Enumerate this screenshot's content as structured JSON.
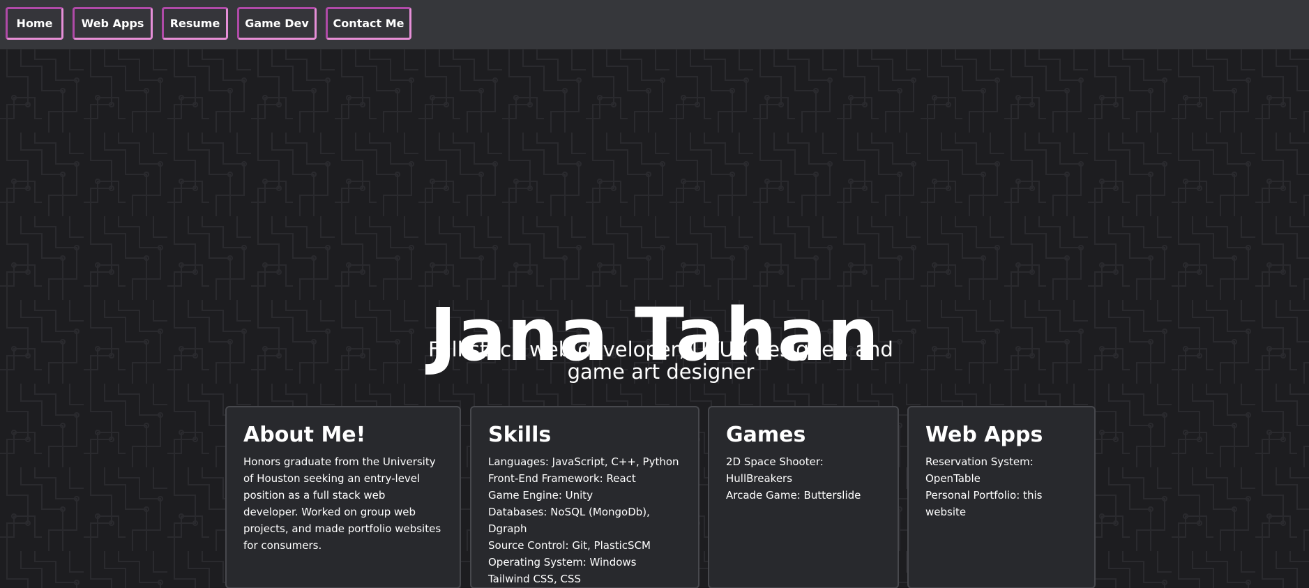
{
  "nav": {
    "items": [
      {
        "label": "Home"
      },
      {
        "label": "Web Apps"
      },
      {
        "label": "Resume"
      },
      {
        "label": "Game Dev"
      },
      {
        "label": "Contact Me"
      }
    ]
  },
  "hero": {
    "name": "Jana Tahan",
    "tagline": "Full stack web developer, UI/UX designer, and game art designer"
  },
  "cards": {
    "about": {
      "title": "About Me!",
      "text": "Honors graduate from the University of Houston seeking an entry-level position as a full stack web developer. Worked on group web projects, and made portfolio websites for consumers."
    },
    "skills": {
      "title": "Skills",
      "lines": [
        "Languages: JavaScript, C++, Python",
        "Front-End Framework: React",
        "Game Engine: Unity",
        "Databases: NoSQL (MongoDb), Dgraph",
        "Source Control: Git, PlasticSCM",
        "Operating System: Windows",
        "Tailwind CSS, CSS"
      ]
    },
    "games": {
      "title": "Games",
      "lines": [
        "2D Space Shooter: HullBreakers",
        "Arcade Game: Butterslide"
      ]
    },
    "webapps": {
      "title": "Web Apps",
      "lines": [
        "Reservation System: OpenTable",
        "Personal Portfolio: this website"
      ]
    }
  },
  "colors": {
    "navbar_bg": "#36373b",
    "page_bg": "#1d1d20",
    "card_bg": "#28292d",
    "accent_border": "#b04aa8",
    "accent_border_light": "#e68fd8"
  }
}
